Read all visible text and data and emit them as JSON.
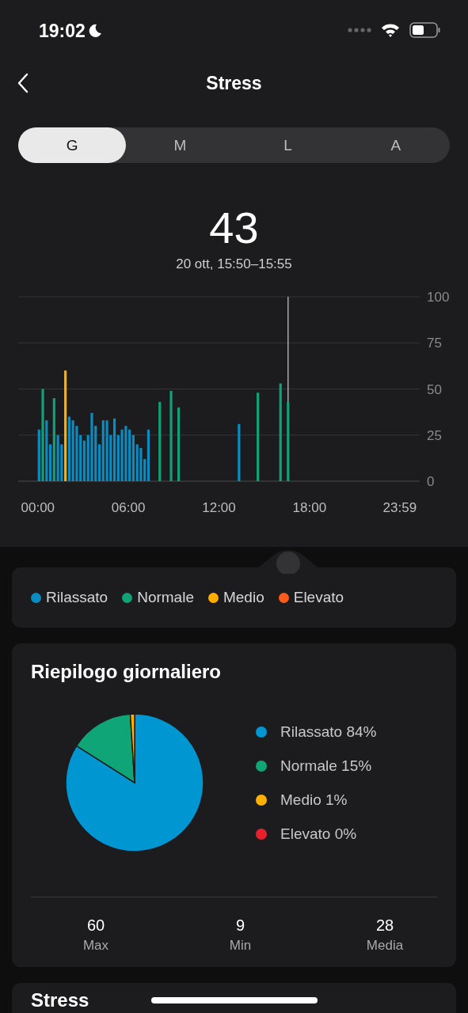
{
  "status_bar": {
    "time": "19:02"
  },
  "header": {
    "title": "Stress"
  },
  "tabs": [
    {
      "label": "G",
      "selected": true
    },
    {
      "label": "M",
      "selected": false
    },
    {
      "label": "L",
      "selected": false
    },
    {
      "label": "A",
      "selected": false
    }
  ],
  "reading": {
    "value": "43",
    "period": "20 ott, 15:50–15:55"
  },
  "stress_chart": {
    "chart_data": {
      "type": "bar",
      "grid": true,
      "xlim": [
        -1.3,
        25.3
      ],
      "ylim": [
        0,
        100
      ],
      "yticks": [
        0,
        25,
        50,
        75,
        100
      ],
      "xticks": [
        {
          "value": 0,
          "label": "00:00"
        },
        {
          "value": 6,
          "label": "06:00"
        },
        {
          "value": 12,
          "label": "12:00"
        },
        {
          "value": 18,
          "label": "18:00"
        },
        {
          "value": 23.98,
          "label": "23:59"
        }
      ],
      "ref_lines": [
        {
          "axis": "x",
          "value": 16.5
        }
      ],
      "x": [
        0,
        0.25,
        0.5,
        0.75,
        1,
        1.25,
        1.5,
        1.75,
        2,
        2.25,
        2.5,
        2.75,
        3,
        3.25,
        3.5,
        3.75,
        4,
        4.25,
        4.5,
        4.75,
        5,
        5.25,
        5.5,
        5.75,
        6,
        6.25,
        6.5,
        6.75,
        7,
        7.25,
        8,
        8.75,
        9.25,
        13.25,
        14.5,
        16,
        16.5
      ],
      "series": [
        {
          "name": "Rilassato",
          "color": "#0a8cc0",
          "values": [
            28,
            null,
            33,
            20,
            null,
            25,
            20,
            null,
            35,
            33,
            30,
            25,
            22,
            25,
            37,
            30,
            20,
            33,
            33,
            25,
            34,
            25,
            28,
            30,
            28,
            25,
            20,
            18,
            12,
            28,
            null,
            null,
            null,
            31,
            null,
            null,
            null
          ]
        },
        {
          "name": "Normale",
          "color": "#10a176",
          "values": [
            null,
            50,
            null,
            null,
            45,
            null,
            null,
            null,
            null,
            null,
            null,
            null,
            null,
            null,
            null,
            null,
            null,
            null,
            null,
            null,
            null,
            null,
            null,
            null,
            null,
            null,
            null,
            null,
            null,
            null,
            43,
            49,
            40,
            null,
            48,
            53,
            43
          ]
        },
        {
          "name": "Medio",
          "color": "#ffae00",
          "values": [
            null,
            null,
            null,
            null,
            null,
            null,
            null,
            60,
            null,
            null,
            null,
            null,
            null,
            null,
            null,
            null,
            null,
            null,
            null,
            null,
            null,
            null,
            null,
            null,
            null,
            null,
            null,
            null,
            null,
            null,
            null,
            null,
            null,
            null,
            null,
            null,
            null
          ]
        },
        {
          "name": "Elevato",
          "color": "#ff5a1a",
          "values": [
            null,
            null,
            null,
            null,
            null,
            null,
            null,
            null,
            null,
            null,
            null,
            null,
            null,
            null,
            null,
            null,
            null,
            null,
            null,
            null,
            null,
            null,
            null,
            null,
            null,
            null,
            null,
            null,
            null,
            null,
            null,
            null,
            null,
            null,
            null,
            null,
            null
          ]
        }
      ]
    }
  },
  "daily_summary": {
    "title": "Riepilogo giornaliero",
    "chart_data": {
      "type": "pie",
      "categories": [
        "Rilassato 84%",
        "Normale 15%",
        "Medio 1%",
        "Elevato 0%"
      ],
      "values": [
        84,
        15,
        1,
        0
      ],
      "colors": [
        "#0096d2",
        "#0fa577",
        "#ffb000",
        "#e8202e"
      ]
    },
    "stats": [
      {
        "value": "60",
        "label": "Max"
      },
      {
        "value": "9",
        "label": "Min"
      },
      {
        "value": "28",
        "label": "Media"
      }
    ]
  },
  "next_card": {
    "title": "Stress"
  }
}
